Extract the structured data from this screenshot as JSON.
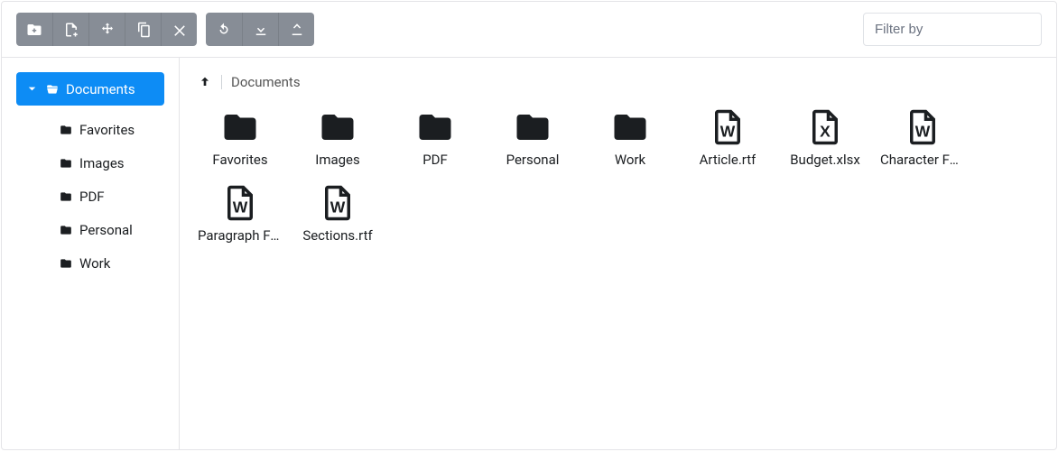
{
  "toolbar": {
    "buttons_a": [
      "new-folder",
      "new-file",
      "move",
      "copy",
      "delete"
    ],
    "buttons_b": [
      "refresh",
      "download",
      "upload"
    ]
  },
  "filter": {
    "placeholder": "Filter by"
  },
  "sidebar": {
    "root": "Documents",
    "items": [
      {
        "label": "Favorites"
      },
      {
        "label": "Images"
      },
      {
        "label": "PDF"
      },
      {
        "label": "Personal"
      },
      {
        "label": "Work"
      }
    ]
  },
  "breadcrumb": {
    "current": "Documents"
  },
  "grid": {
    "items": [
      {
        "name": "Favorites",
        "kind": "folder"
      },
      {
        "name": "Images",
        "kind": "folder"
      },
      {
        "name": "PDF",
        "kind": "folder"
      },
      {
        "name": "Personal",
        "kind": "folder"
      },
      {
        "name": "Work",
        "kind": "folder"
      },
      {
        "name": "Article.rtf",
        "kind": "word"
      },
      {
        "name": "Budget.xlsx",
        "kind": "excel"
      },
      {
        "name": "Character Formatting.rtf",
        "kind": "word"
      },
      {
        "name": "Paragraph Formatting.rtf",
        "kind": "word"
      },
      {
        "name": "Sections.rtf",
        "kind": "word"
      }
    ]
  }
}
